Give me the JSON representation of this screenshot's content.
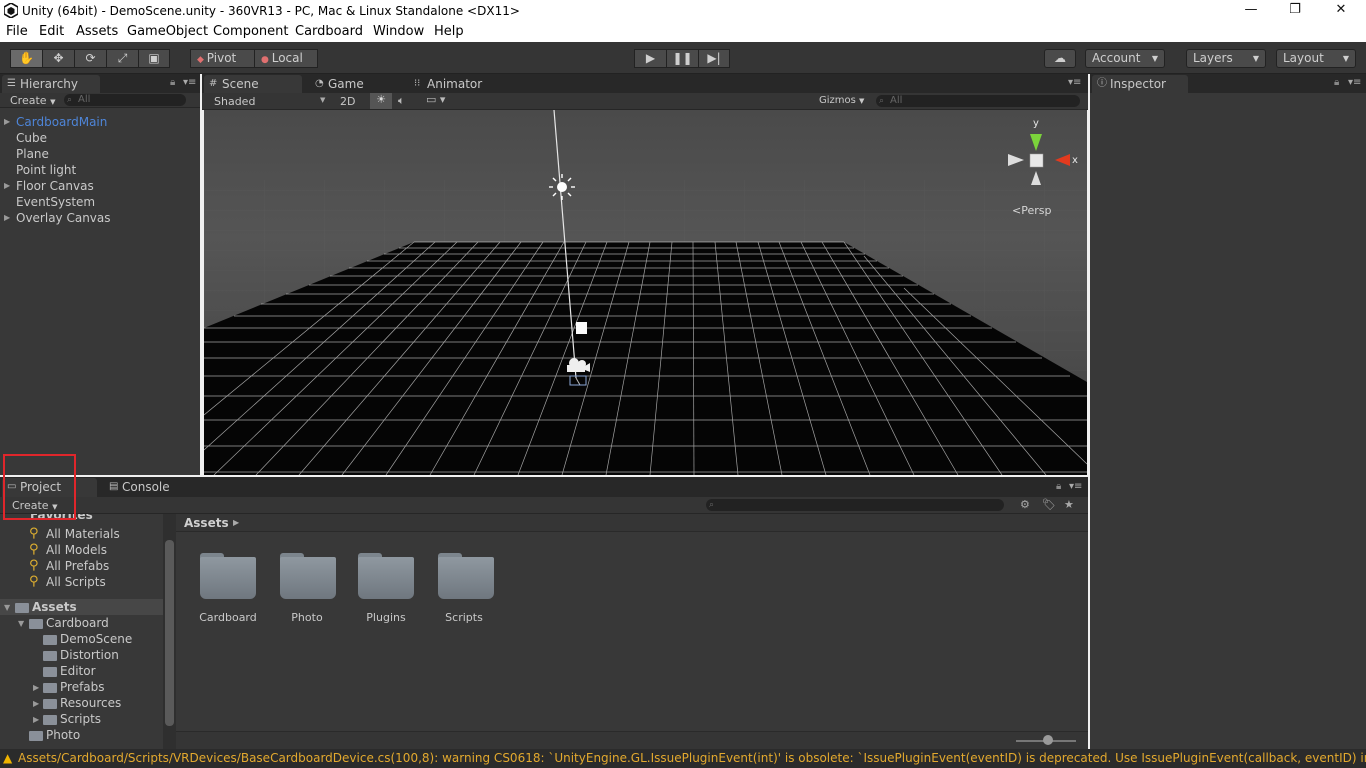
{
  "window": {
    "title": "Unity (64bit) - DemoScene.unity - 360VR13 - PC, Mac & Linux Standalone <DX11>",
    "controls": [
      "—",
      "❐",
      "✕"
    ]
  },
  "menu": [
    "File",
    "Edit",
    "Assets",
    "GameObject",
    "Component",
    "Cardboard",
    "Window",
    "Help"
  ],
  "toolbar": {
    "tools": [
      "hand-icon",
      "move-icon",
      "rotate-icon",
      "scale-icon",
      "rect-icon"
    ],
    "pivot": "Pivot",
    "local": "Local",
    "account": "Account",
    "layers": "Layers",
    "layout": "Layout"
  },
  "hierarchy": {
    "tab": "Hierarchy",
    "create": "Create",
    "search_placeholder": "All",
    "items": [
      {
        "label": "CardboardMain",
        "expandable": true,
        "selected": true
      },
      {
        "label": "Cube",
        "expandable": false
      },
      {
        "label": "Plane",
        "expandable": false
      },
      {
        "label": "Point light",
        "expandable": false
      },
      {
        "label": "Floor Canvas",
        "expandable": true
      },
      {
        "label": "EventSystem",
        "expandable": false
      },
      {
        "label": "Overlay Canvas",
        "expandable": true
      }
    ]
  },
  "scene": {
    "tabs": [
      "Scene",
      "Game",
      "Animator"
    ],
    "active_tab": "Scene",
    "shading": "Shaded",
    "mode_2d": "2D",
    "gizmos": "Gizmos",
    "search_placeholder": "All",
    "gizmo_axes": {
      "y": "y",
      "x": "x"
    },
    "persp": "Persp"
  },
  "inspector": {
    "tab": "Inspector"
  },
  "project": {
    "tabs": [
      "Project",
      "Console"
    ],
    "create": "Create",
    "favorites_label": "Favorites",
    "favorites": [
      "All Materials",
      "All Models",
      "All Prefabs",
      "All Scripts"
    ],
    "tree": [
      {
        "label": "Assets",
        "level": 0,
        "expanded": true
      },
      {
        "label": "Cardboard",
        "level": 1,
        "expanded": true
      },
      {
        "label": "DemoScene",
        "level": 2
      },
      {
        "label": "Distortion",
        "level": 2
      },
      {
        "label": "Editor",
        "level": 2
      },
      {
        "label": "Prefabs",
        "level": 2,
        "expandable": true
      },
      {
        "label": "Resources",
        "level": 2,
        "expandable": true
      },
      {
        "label": "Scripts",
        "level": 2,
        "expandable": true
      },
      {
        "label": "Photo",
        "level": 1
      }
    ],
    "breadcrumb": "Assets",
    "folders": [
      "Cardboard",
      "Photo",
      "Plugins",
      "Scripts"
    ]
  },
  "status": {
    "message": "Assets/Cardboard/Scripts/VRDevices/BaseCardboardDevice.cs(100,8): warning CS0618: `UnityEngine.GL.IssuePluginEvent(int)' is obsolete: `IssuePluginEvent(eventID) is deprecated. Use IssuePluginEvent(callback, eventID) instead.'"
  },
  "colors": {
    "accent_selected": "#4e85d8",
    "panel": "#383838",
    "warning": "#e3a92e",
    "highlight_box": "#e0262b"
  }
}
